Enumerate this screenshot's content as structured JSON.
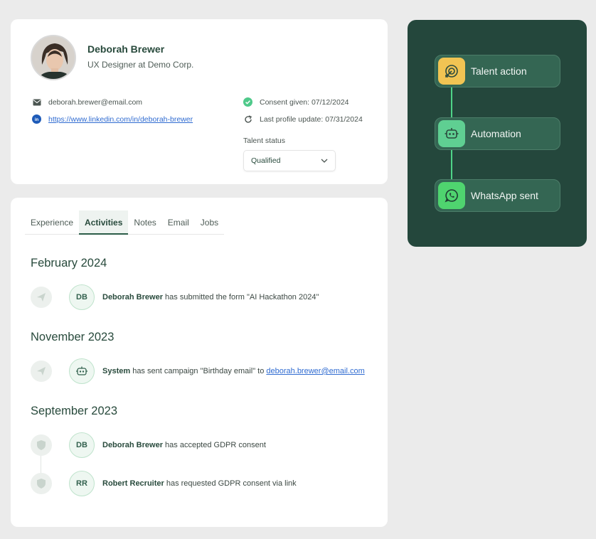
{
  "profile": {
    "name": "Deborah Brewer",
    "job_title": "UX Designer at Demo Corp.",
    "email": "deborah.brewer@email.com",
    "linkedin": "https://www.linkedin.com/in/deborah-brewer",
    "consent": "Consent given: 07/12/2024",
    "last_update": "Last profile update: 07/31/2024",
    "status_label": "Talent status",
    "status_value": "Qualified"
  },
  "tabs": [
    {
      "label": "Experience"
    },
    {
      "label": "Activities"
    },
    {
      "label": "Notes"
    },
    {
      "label": "Email"
    },
    {
      "label": "Jobs"
    }
  ],
  "activity": {
    "groups": [
      {
        "month": "February 2024",
        "items": [
          {
            "initials": "DB",
            "actor": "Deborah Brewer",
            "text": " has submitted the form \"AI Hackathon 2024\""
          }
        ]
      },
      {
        "month": "November 2023",
        "items": [
          {
            "actor": "System",
            "text": " has sent campaign \"Birthday email\" to ",
            "link": "deborah.brewer@email.com"
          }
        ]
      },
      {
        "month": "September 2023",
        "items": [
          {
            "initials": "DB",
            "actor": "Deborah Brewer",
            "text": " has accepted GDPR consent"
          },
          {
            "initials": "RR",
            "actor": "Robert Recruiter",
            "text": " has requested GDPR consent via link"
          }
        ]
      }
    ]
  },
  "flow": {
    "nodes": [
      {
        "label": "Talent action",
        "icon": "target-icon",
        "color": "#f1c453"
      },
      {
        "label": "Automation",
        "icon": "robot-icon",
        "color": "#5fcf92"
      },
      {
        "label": "WhatsApp sent",
        "icon": "whatsapp-icon",
        "color": "#4fd46f"
      }
    ]
  },
  "colors": {
    "accent_dark_green": "#24473c",
    "link_blue": "#2f6bd1",
    "success_green": "#4fc98a"
  }
}
